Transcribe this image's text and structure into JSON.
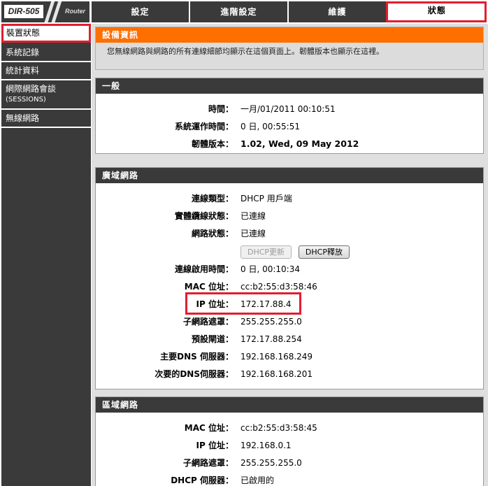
{
  "logo": {
    "model": "DIR-505",
    "tag": "Router"
  },
  "topnav": [
    "設定",
    "進階設定",
    "維護",
    "狀態"
  ],
  "sidebar": [
    "裝置狀態",
    "系統記錄",
    "統計資料",
    "網際網路會談",
    "(SESSIONS)",
    "無線網路"
  ],
  "info": {
    "title": "設備資訊",
    "text": "您無線網路與網路的所有連線細節均顯示在這個頁面上。韌體版本也顯示在這裡。"
  },
  "general": {
    "title": "一般",
    "rows": [
      {
        "label": "時間：",
        "value": "一月/01/2011 00:10:51"
      },
      {
        "label": "系統運作時間：",
        "value": "0 日, 00:55:51"
      },
      {
        "label": "韌體版本：",
        "value": "1.02,  Wed, 09 May 2012"
      }
    ]
  },
  "wan": {
    "title": "廣域網路",
    "rows": [
      {
        "label": "連線類型：",
        "value": "DHCP 用戶端"
      },
      {
        "label": "實體纜線狀態：",
        "value": "已連線"
      },
      {
        "label": "網路狀態：",
        "value": "已連線"
      },
      {
        "label": "連線啟用時間：",
        "value": "0 日, 00:10:34"
      },
      {
        "label": "MAC 位址：",
        "value": "cc:b2:55:d3:58:46"
      },
      {
        "label": "IP 位址：",
        "value": "172.17.88.4"
      },
      {
        "label": "子網路遮罩：",
        "value": "255.255.255.0"
      },
      {
        "label": "預設閘道：",
        "value": "172.17.88.254"
      },
      {
        "label": "主要DNS 伺服器：",
        "value": "192.168.168.249"
      },
      {
        "label": "次要的DNS伺服器：",
        "value": "192.168.168.201"
      }
    ],
    "buttons": {
      "renew": "DHCP更新",
      "release": "DHCP釋放"
    }
  },
  "lan": {
    "title": "區域網路",
    "rows": [
      {
        "label": "MAC 位址：",
        "value": "cc:b2:55:d3:58:45"
      },
      {
        "label": "IP 位址：",
        "value": "192.168.0.1"
      },
      {
        "label": "子網路遮罩：",
        "value": "255.255.255.0"
      },
      {
        "label": "DHCP 伺服器：",
        "value": "已啟用的"
      }
    ]
  }
}
